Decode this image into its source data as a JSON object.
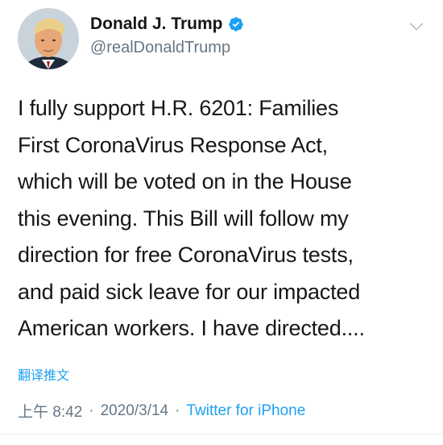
{
  "author": {
    "display_name": "Donald J. Trump",
    "handle": "@realDonaldTrump",
    "verified": true,
    "avatar_icon": "profile-photo-avatar",
    "verified_icon": "verified-badge-icon"
  },
  "tweet": {
    "text_lines": [
      "I fully support H.R. 6201: Families",
      "First CoronaVirus Response Act,",
      "which will be voted on in the House",
      "this evening. This Bill will follow my",
      "direction for free CoronaVirus tests,",
      "and paid sick leave for our impacted",
      "American workers. I have directed...."
    ],
    "translate_label": "翻译推文"
  },
  "meta": {
    "time": "上午 8:42",
    "separator": "·",
    "date": "2020/3/14",
    "source": "Twitter for iPhone"
  },
  "menu": {
    "caret_icon": "chevron-down-icon"
  },
  "colors": {
    "link": "#1da1f2",
    "secondary_text": "#657786",
    "primary_text": "#14171a",
    "verified": "#1da1f2"
  }
}
